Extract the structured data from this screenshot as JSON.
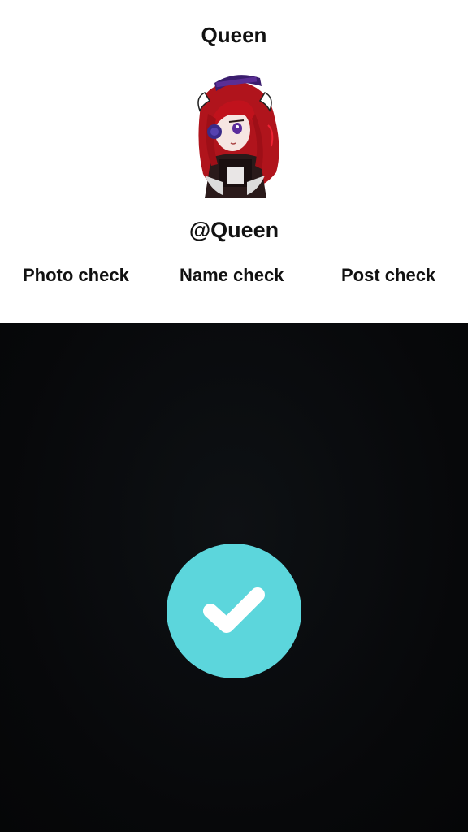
{
  "profile": {
    "title": "Queen",
    "handle": "@Queen",
    "avatar_icon": "avatar-anime-character"
  },
  "tabs": [
    {
      "label": "Photo check"
    },
    {
      "label": "Name check"
    },
    {
      "label": "Post check"
    }
  ],
  "result": {
    "icon": "check-icon",
    "accent_color": "#5cd6dc",
    "background_color": "#07080a"
  }
}
